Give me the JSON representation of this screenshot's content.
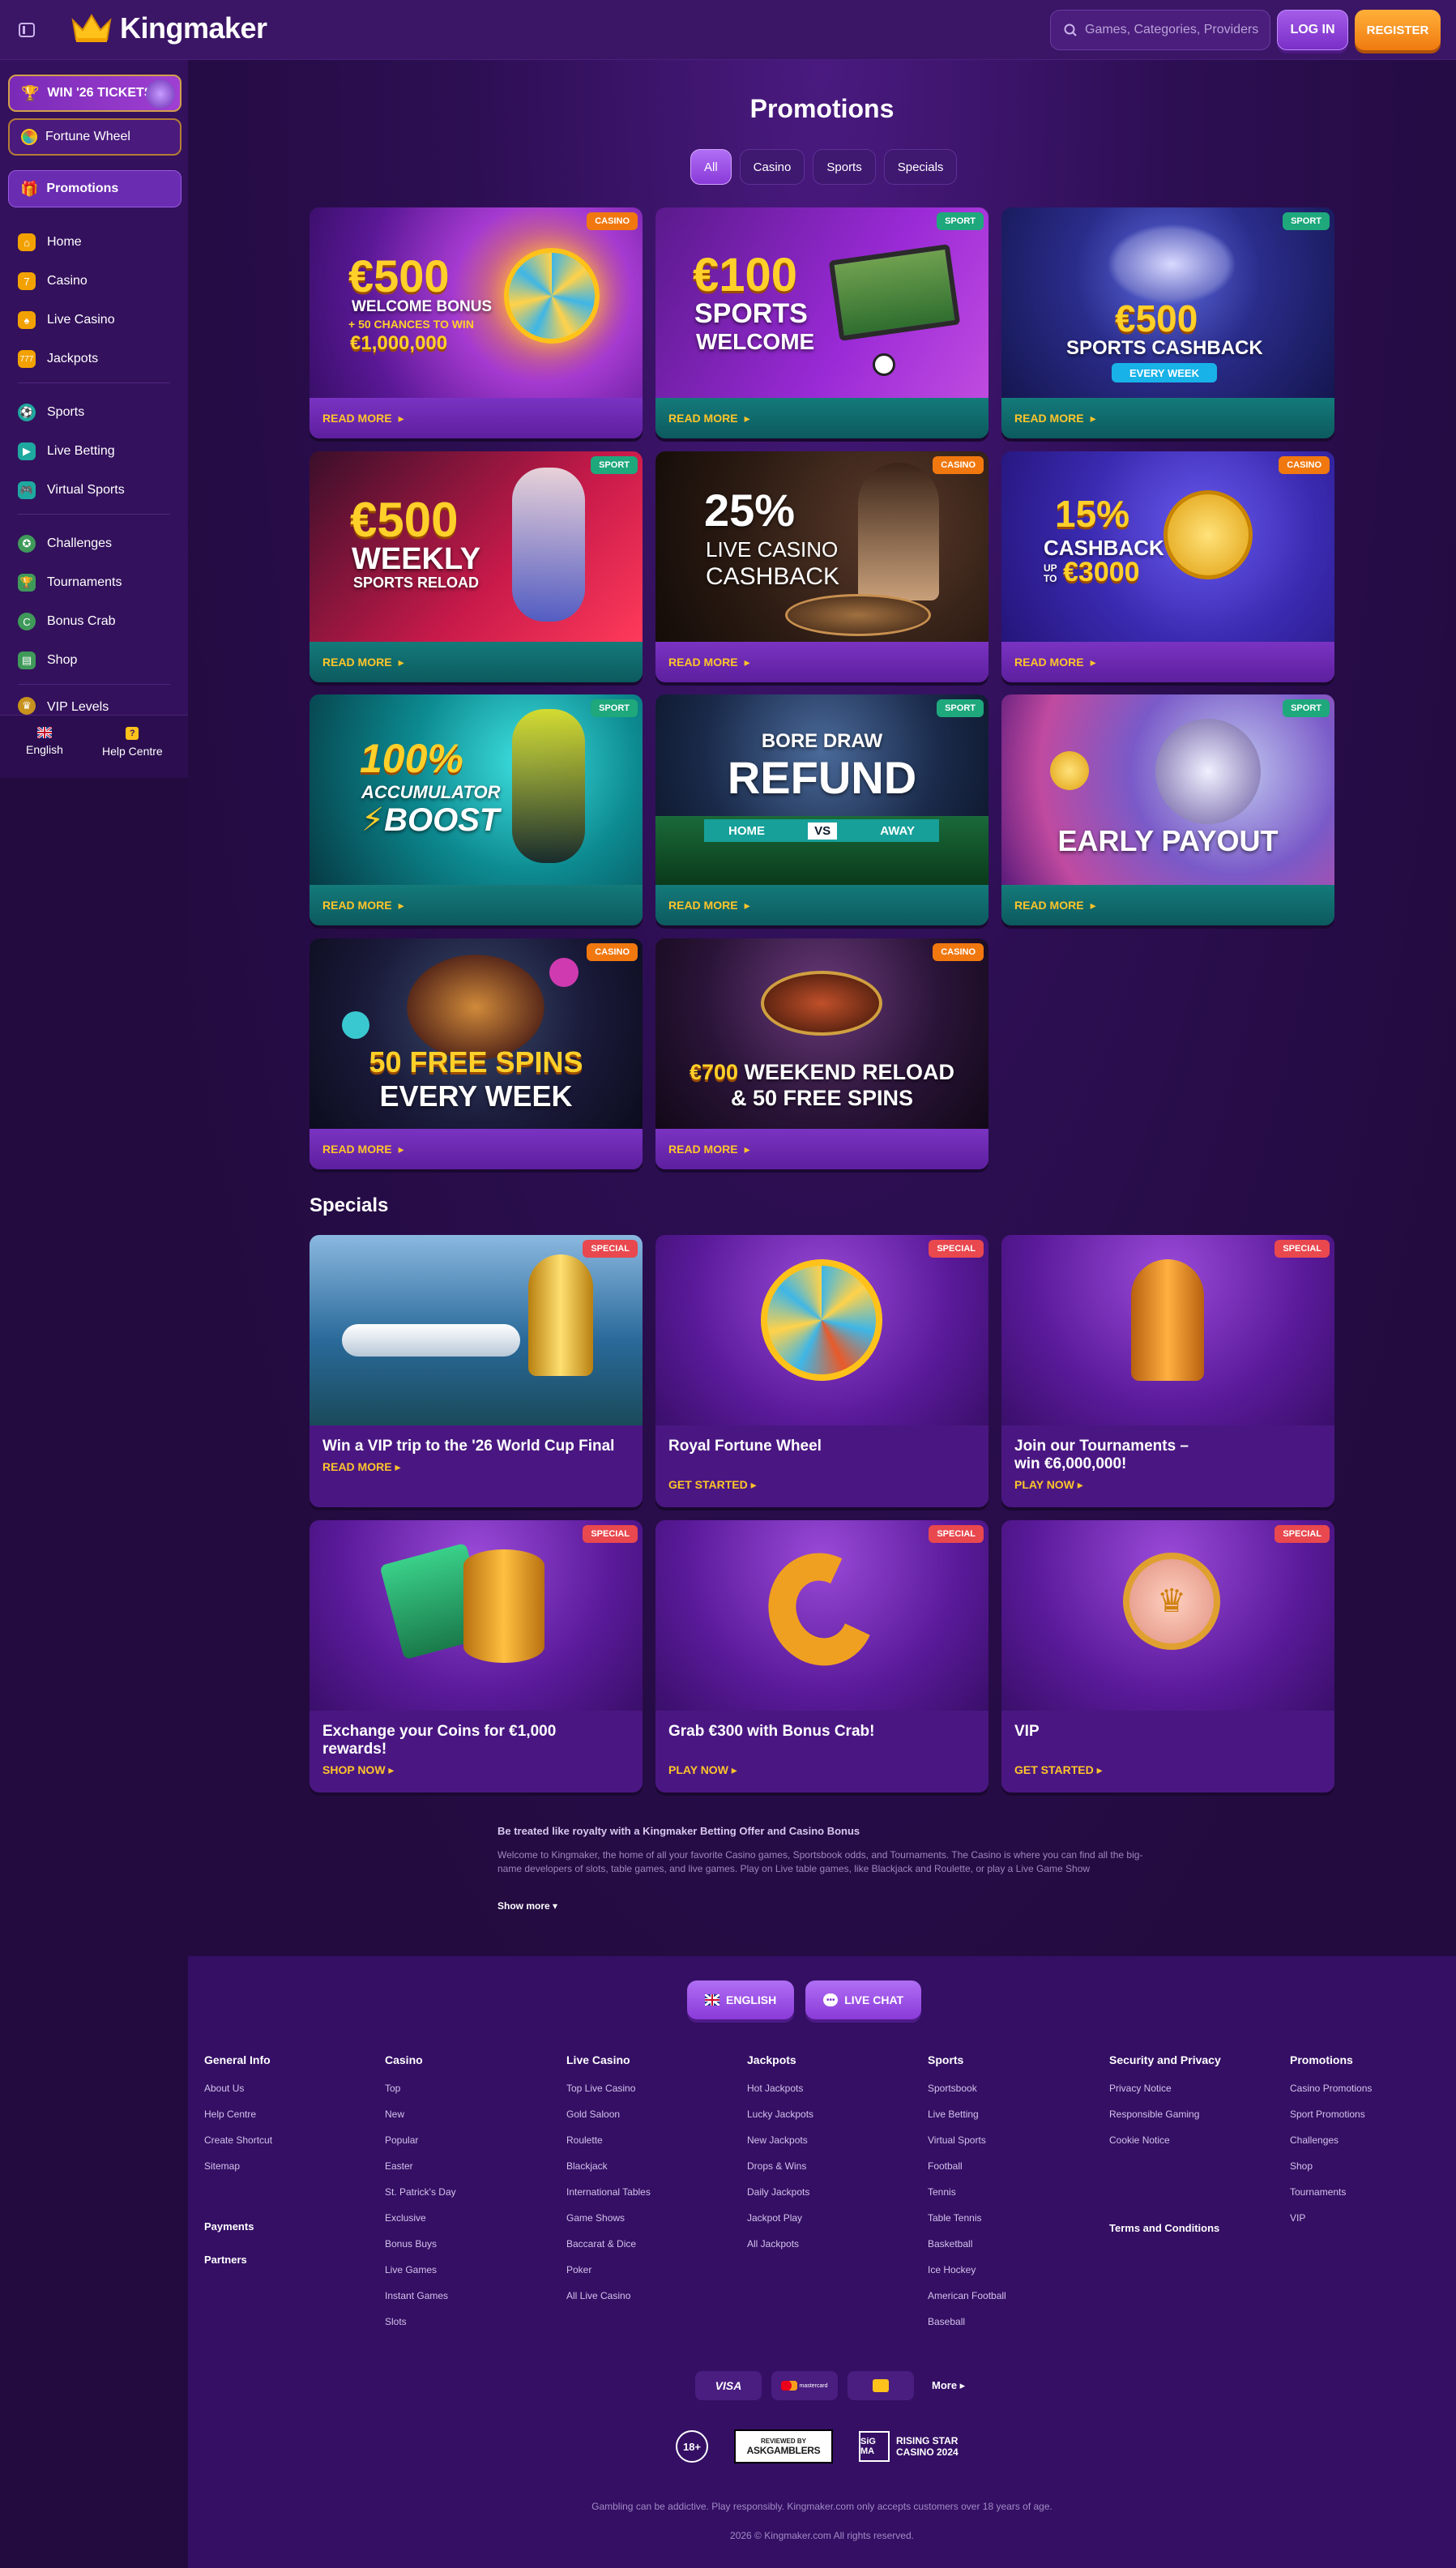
{
  "header": {
    "brand": "Kingmaker",
    "search_placeholder": "Games, Categories, Providers",
    "login": "LOG IN",
    "register": "REGISTER",
    "colors": {
      "accent": "#8a3ad8",
      "cta": "#f07a10"
    }
  },
  "sidebar": {
    "tickets": "WIN '26 TICKETS",
    "wheel": "Fortune Wheel",
    "promotions": "Promotions",
    "items": [
      "Home",
      "Casino",
      "Live Casino",
      "Jackpots",
      "Sports",
      "Live Betting",
      "Virtual Sports",
      "Challenges",
      "Tournaments",
      "Bonus Crab",
      "Shop",
      "VIP Levels"
    ],
    "language": "English",
    "help": "Help Centre"
  },
  "main": {
    "title": "Promotions",
    "filters": [
      "All",
      "Casino",
      "Sports",
      "Specials"
    ],
    "promos": [
      {
        "badge": "CASINO",
        "line1": "€500",
        "line2": "WELCOME BONUS",
        "line3": "+ 50 CHANCES TO WIN",
        "line4": "€1,000,000",
        "cta": "READ MORE"
      },
      {
        "badge": "SPORT",
        "line1": "€100",
        "line2": "SPORTS",
        "line3": "WELCOME",
        "cta": "READ MORE"
      },
      {
        "badge": "SPORT",
        "line1": "€500",
        "line2": "SPORTS CASHBACK",
        "line3": "EVERY WEEK",
        "cta": "READ MORE"
      },
      {
        "badge": "SPORT",
        "line1": "€500",
        "line2": "WEEKLY",
        "line3": "SPORTS RELOAD",
        "cta": "READ MORE"
      },
      {
        "badge": "CASINO",
        "line1": "25%",
        "line2": "LIVE CASINO",
        "line3": "CASHBACK",
        "cta": "READ MORE"
      },
      {
        "badge": "CASINO",
        "line1": "15%",
        "line2": "CASHBACK",
        "line3": "UP TO",
        "line4": "€3000",
        "cta": "READ MORE"
      },
      {
        "badge": "SPORT",
        "line1": "100%",
        "line2": "ACCUMULATOR",
        "line3": "BOOST",
        "cta": "READ MORE"
      },
      {
        "badge": "SPORT",
        "line1": "BORE DRAW",
        "line2": "REFUND",
        "line3": "HOME",
        "line4": "AWAY",
        "vs": "VS",
        "cta": "READ MORE"
      },
      {
        "badge": "SPORT",
        "line1": "EARLY PAYOUT",
        "cta": "READ MORE"
      },
      {
        "badge": "CASINO",
        "line1": "50 FREE SPINS",
        "line2": "EVERY WEEK",
        "cta": "READ MORE"
      },
      {
        "badge": "CASINO",
        "line1": "€700",
        "line2": "WEEKEND RELOAD",
        "line3": "& 50 FREE SPINS",
        "cta": "READ MORE"
      }
    ],
    "specials_title": "Specials",
    "specials": [
      {
        "badge": "SPECIAL",
        "title": "Win a VIP trip to the '26 World Cup Final",
        "cta": "READ MORE"
      },
      {
        "badge": "SPECIAL",
        "title": "Royal Fortune Wheel",
        "cta": "GET STARTED"
      },
      {
        "badge": "SPECIAL",
        "title": "Join our Tournaments – win €6,000,000!",
        "cta": "PLAY NOW"
      },
      {
        "badge": "SPECIAL",
        "title": "Exchange your Coins for €1,000 rewards!",
        "cta": "SHOP NOW"
      },
      {
        "badge": "SPECIAL",
        "title": "Grab €300 with Bonus Crab!",
        "cta": "PLAY NOW"
      },
      {
        "badge": "SPECIAL",
        "title": "VIP",
        "cta": "GET STARTED"
      }
    ],
    "seo_title": "Be treated like royalty with a Kingmaker Betting Offer and Casino Bonus",
    "seo_text": "Welcome to Kingmaker, the home of all your favorite Casino games, Sportsbook odds, and Tournaments. The Casino is where you can find all the big-name developers of slots, table games, and live games. Play on Live table games, like Blackjack and Roulette, or play a Live Game Show",
    "show_more": "Show more"
  },
  "footer": {
    "lang_btn": "ENGLISH",
    "chat_btn": "LIVE CHAT",
    "columns": [
      {
        "title": "General Info",
        "links": [
          "About Us",
          "Help Centre",
          "Create Shortcut",
          "Sitemap"
        ]
      },
      {
        "title": "Casino",
        "links": [
          "Top",
          "New",
          "Popular",
          "Easter",
          "St. Patrick's Day",
          "Exclusive",
          "Bonus Buys",
          "Live Games",
          "Instant Games",
          "Slots"
        ]
      },
      {
        "title": "Live Casino",
        "links": [
          "Top Live Casino",
          "Gold Saloon",
          "Roulette",
          "Blackjack",
          "International Tables",
          "Game Shows",
          "Baccarat & Dice",
          "Poker",
          "All Live Casino"
        ]
      },
      {
        "title": "Jackpots",
        "links": [
          "Hot Jackpots",
          "Lucky Jackpots",
          "New Jackpots",
          "Drops & Wins",
          "Daily Jackpots",
          "Jackpot Play",
          "All Jackpots"
        ]
      },
      {
        "title": "Sports",
        "links": [
          "Sportsbook",
          "Live Betting",
          "Virtual Sports",
          "Football",
          "Tennis",
          "Table Tennis",
          "Basketball",
          "Ice Hockey",
          "American Football",
          "Baseball"
        ]
      },
      {
        "title": "Security and Privacy",
        "links": [
          "Privacy Notice",
          "Responsible Gaming",
          "Cookie Notice"
        ]
      },
      {
        "title": "Promotions",
        "links": [
          "Casino Promotions",
          "Sport Promotions",
          "Challenges",
          "Shop",
          "Tournaments",
          "VIP"
        ]
      }
    ],
    "payments": "Payments",
    "partners": "Partners",
    "terms": "Terms and Conditions",
    "pay_visa": "VISA",
    "pay_mc": "mastercard",
    "pay_more": "More",
    "age": "18+",
    "askg_1": "REVIEWED BY",
    "askg_2": "ASKGAMBLERS",
    "sigma_logo": "SiG MA",
    "sigma_1": "RISING STAR",
    "sigma_2": "CASINO 2024",
    "disclaimer": "Gambling can be addictive. Play responsibly. Kingmaker.com only accepts customers over 18 years of age.",
    "copyright": "2026 © Kingmaker.com All rights reserved."
  }
}
